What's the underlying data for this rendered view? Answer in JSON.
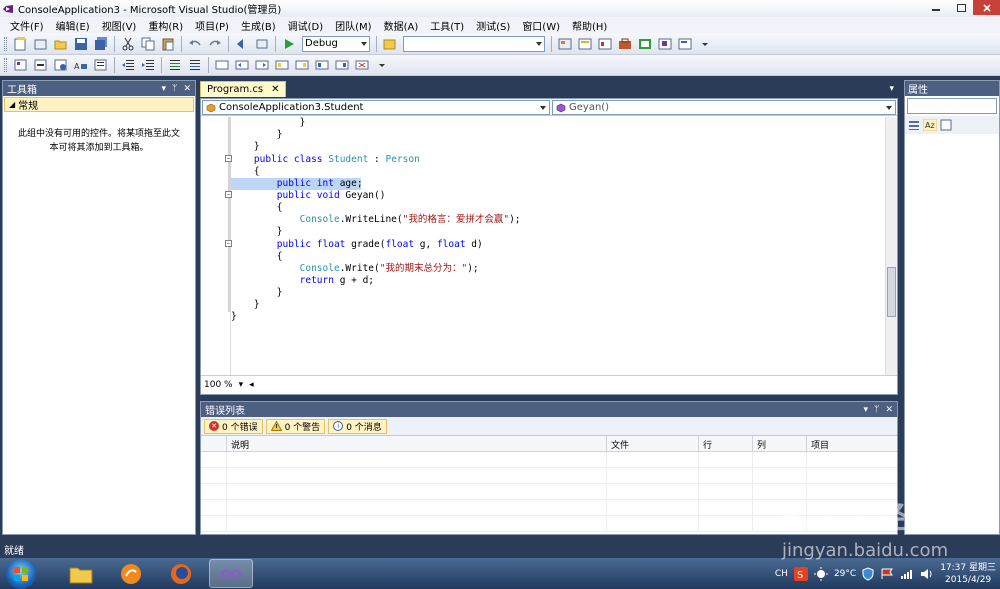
{
  "window": {
    "title": "ConsoleApplication3 - Microsoft Visual Studio(管理员)"
  },
  "menu": [
    "文件(F)",
    "编辑(E)",
    "视图(V)",
    "重构(R)",
    "项目(P)",
    "生成(B)",
    "调试(D)",
    "团队(M)",
    "数据(A)",
    "工具(T)",
    "测试(S)",
    "窗口(W)",
    "帮助(H)"
  ],
  "toolbar": {
    "config": "Debug",
    "platform": ""
  },
  "toolbox": {
    "title": "工具箱",
    "group": "常规",
    "empty_msg": "此组中没有可用的控件。将某项拖至此文本可将其添加到工具箱。"
  },
  "editor": {
    "tab": "Program.cs",
    "class_combo": "ConsoleApplication3.Student",
    "member_combo": "Geyan()",
    "zoom": "100 %"
  },
  "code": {
    "l1": "            }",
    "l2": "        }",
    "l3": "    }",
    "l4_kw": "public class ",
    "l4_ty": "Student",
    "l4_mid": " : ",
    "l4_base": "Person",
    "l5": "    {",
    "l6_kw": "public int",
    "l6_rest": " age;",
    "l7_kw": "public void",
    "l7_rest": " Geyan()",
    "l8": "        {",
    "l9_ty": "Console",
    "l9_mid": ".WriteLine(",
    "l9_str": "\"我的格言：爱拼才会赢\"",
    "l9_end": ");",
    "l10": "        }",
    "l11_kw1": "public float",
    "l11_mid": " grade(",
    "l11_kw2": "float",
    "l11_mid2": " g, ",
    "l11_kw3": "float",
    "l11_end": " d)",
    "l12": "        {",
    "l13_ty": "Console",
    "l13_mid": ".Write(",
    "l13_str": "\"我的期末总分为：\"",
    "l13_end": ");",
    "l14_kw": "return",
    "l14_rest": " g + d;",
    "l15": "        }",
    "l16": "    }",
    "l17": "}"
  },
  "errors": {
    "title": "错误列表",
    "btn_errors": "0 个错误",
    "btn_warnings": "0 个警告",
    "btn_messages": "0 个消息",
    "col_desc": "说明",
    "col_file": "文件",
    "col_line": "行",
    "col_col": "列",
    "col_project": "项目"
  },
  "properties": {
    "title": "属性"
  },
  "status": {
    "text": "就绪"
  },
  "tray": {
    "lang": "CH",
    "temp": "29°C",
    "time": "17:37 星期三",
    "date": "2015/4/29"
  },
  "watermark": {
    "brand": "Baidu经验",
    "url": "jingyan.baidu.com"
  },
  "colors": {
    "accent": "#4d6082",
    "keyword": "#0000ff",
    "type": "#2b91af",
    "string": "#a31515",
    "selection": "#bed6f5"
  }
}
